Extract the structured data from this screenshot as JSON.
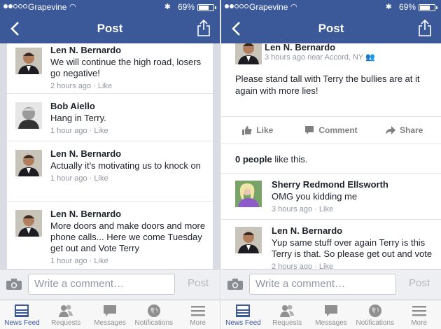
{
  "status": {
    "carrier": "Grapevine",
    "battery": "69%"
  },
  "nav": {
    "title": "Post"
  },
  "left": {
    "comments": [
      {
        "name": "Len N. Bernardo",
        "text": "We will continue the high road, losers go negative!",
        "time": "2 hours ago",
        "like": "Like"
      },
      {
        "name": "Bob Aiello",
        "text": "Hang in Terry.",
        "time": "1 hour ago",
        "like": "Like"
      },
      {
        "name": "Len N. Bernardo",
        "text": "Actually it's motivating us to knock on",
        "time": "1 hour ago",
        "like": "Like"
      },
      {
        "name": "Len N. Bernardo",
        "text": "More doors and make doors and more phone calls... Here we come Tuesday get out and Vote Terry",
        "time": "1 hour ago",
        "like": "Like"
      }
    ]
  },
  "right": {
    "post": {
      "name": "Len N. Bernardo",
      "meta": "3 hours ago near Accord, NY",
      "text": "Please stand tall with Terry the bullies are at it again with more lies!"
    },
    "actions": {
      "like": "Like",
      "comment": "Comment",
      "share": "Share"
    },
    "likes": {
      "count": "0 people",
      "suffix": " like this."
    },
    "comments": [
      {
        "name": "Sherry Redmond Ellsworth",
        "text": "OMG you kidding me",
        "time": "3 hours ago",
        "like": "Like"
      },
      {
        "name": "Len N. Bernardo",
        "text": "Yup same stuff over again Terry is this Terry is that. So please get out and vote",
        "time": "2 hours ago",
        "like": "Like"
      }
    ]
  },
  "composer": {
    "placeholder": "Write a comment…",
    "post": "Post"
  },
  "tabs": [
    {
      "label": "News Feed",
      "icon": "news-feed-icon",
      "active": true
    },
    {
      "label": "Requests",
      "icon": "requests-icon"
    },
    {
      "label": "Messages",
      "icon": "messages-icon"
    },
    {
      "label": "Notifications",
      "icon": "notifications-icon"
    },
    {
      "label": "More",
      "icon": "more-icon"
    }
  ],
  "colors": {
    "brand": "#3b5998",
    "meta": "#9197a3"
  }
}
